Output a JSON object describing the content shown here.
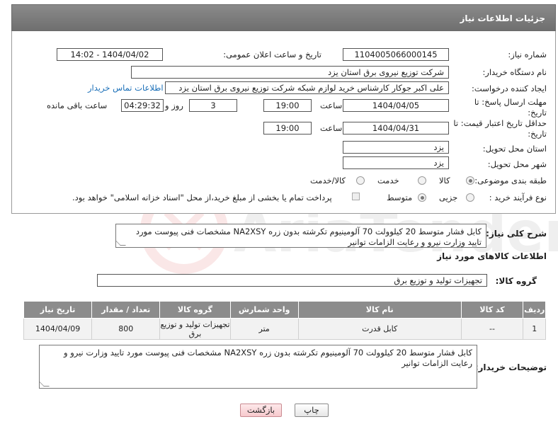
{
  "header": {
    "title": "جزئیات اطلاعات نیاز"
  },
  "form": {
    "need_number_label": "شماره نیاز:",
    "need_number": "1104005066000145",
    "announce_label": "تاریخ و ساعت اعلان عمومی:",
    "announce_value": "1404/04/02 - 14:02",
    "buyer_org_label": "نام دستگاه خریدار:",
    "buyer_org": "شرکت توزیع نیروی برق استان یزد",
    "requester_label": "ایجاد کننده درخواست:",
    "requester": "علی اکبر  جوکار  کارشناس خرید لوازم شبکه   شرکت توزیع نیروی برق استان یزد",
    "buyer_contact_link": "اطلاعات تماس خریدار",
    "reply_deadline_label": "مهلت ارسال پاسخ: تا تاریخ:",
    "reply_date": "1404/04/05",
    "time_label": "ساعت",
    "reply_time": "19:00",
    "days": "3",
    "days_label": "روز و",
    "remaining_time": "04:29:32",
    "remaining_label": "ساعت باقی مانده",
    "price_validity_label": "حداقل تاریخ اعتبار قیمت: تا تاریخ:",
    "validity_date": "1404/04/31",
    "validity_time": "19:00",
    "province_label": "استان محل تحویل:",
    "province": "یزد",
    "city_label": "شهر محل تحویل:",
    "city": "یزد",
    "category_label": "طبقه بندی موضوعی:",
    "category_options": [
      "کالا",
      "خدمت",
      "کالا/خدمت"
    ],
    "purchase_type_label": "نوع فرآیند خرید :",
    "purchase_type_options": [
      "جزیی",
      "متوسط"
    ],
    "payment_note": "پرداخت تمام یا بخشی از مبلغ خرید،از محل \"اسناد خزانه اسلامی\" خواهد بود."
  },
  "description": {
    "label": "شرح کلی نیاز:",
    "text": "کابل فشار متوسط  20 کیلوولت 70 آلومینیوم تکرشته بدون زره  NA2XSY مشخصات فنی پیوست مورد تایید وزارت نیرو و رعایت الزامات توانیر"
  },
  "goods": {
    "section_title": "اطلاعات کالاهای مورد نیاز",
    "group_label": "گروه کالا:",
    "group_value": "تجهیزات تولید و توزیع برق",
    "columns": [
      "ردیف",
      "کد کالا",
      "نام کالا",
      "واحد شمارش",
      "گروه کالا",
      "تعداد / مقدار",
      "تاریخ نیاز"
    ],
    "rows": [
      {
        "row": "1",
        "code": "--",
        "name": "کابل قدرت",
        "unit": "متر",
        "group": "تجهیزات تولید و توزیع برق",
        "qty": "800",
        "date": "1404/04/09"
      }
    ]
  },
  "buyer_notes": {
    "label": "توضیحات خریدار:",
    "text": "کابل فشار متوسط  20 کیلوولت 70 آلومینیوم تکرشته بدون زره  NA2XSY مشخصات فنی پیوست مورد تایید وزارت نیرو و رعایت الزامات توانیر"
  },
  "buttons": {
    "print": "چاپ",
    "back": "بازگشت"
  },
  "watermark": {
    "text": "AriaTender.neT"
  }
}
